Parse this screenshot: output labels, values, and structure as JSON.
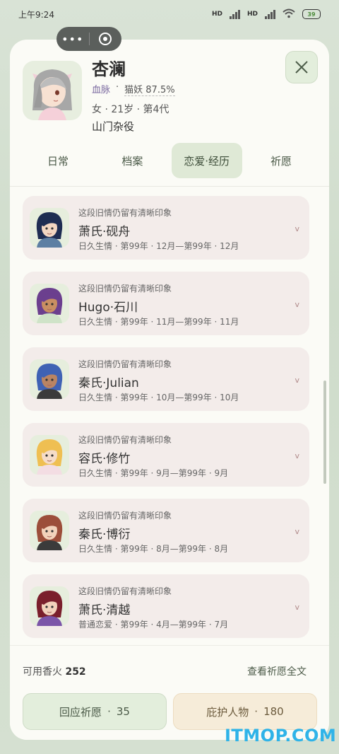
{
  "status_bar": {
    "time": "上午9:24",
    "hd1": "HD",
    "hd2": "HD",
    "battery": "39"
  },
  "profile": {
    "name": "杏澜",
    "lineage_label": "血脉",
    "lineage_value": "猫妖 87.5%",
    "meta": "女 · 21岁 · 第4代",
    "role": "山门杂役"
  },
  "tabs": [
    {
      "label": "日常",
      "active": false
    },
    {
      "label": "档案",
      "active": false
    },
    {
      "label": "恋爱·经历",
      "active": true
    },
    {
      "label": "祈愿",
      "active": false
    }
  ],
  "relationships": [
    {
      "note": "这段旧情仍留有清晰印象",
      "name": "萧氏·砚舟",
      "period": "日久生情 · 第99年 · 12月—第99年 · 12月",
      "hair": "#1e2d52",
      "shirt": "#5d7fa3",
      "skin": "#f2d6c1"
    },
    {
      "note": "这段旧情仍留有清晰印象",
      "name": "Hugo·石川",
      "period": "日久生情 · 第99年 · 11月—第99年 · 11月",
      "hair": "#6b3f8e",
      "shirt": "#cfe3c8",
      "skin": "#c98e62"
    },
    {
      "note": "这段旧情仍留有清晰印象",
      "name": "秦氏·Julian",
      "period": "日久生情 · 第99年 · 10月—第99年 · 10月",
      "hair": "#3f62b4",
      "shirt": "#3b3b3b",
      "skin": "#b98463"
    },
    {
      "note": "这段旧情仍留有清晰印象",
      "name": "容氏·修竹",
      "period": "日久生情 · 第99年 · 9月—第99年 · 9月",
      "hair": "#efbf52",
      "shirt": "#f3dde3",
      "skin": "#f5dcc8"
    },
    {
      "note": "这段旧情仍留有清晰印象",
      "name": "秦氏·博衍",
      "period": "日久生情 · 第99年 · 8月—第99年 · 8月",
      "hair": "#9c4e3a",
      "shirt": "#3b3b3b",
      "skin": "#f2d2bb"
    },
    {
      "note": "这段旧情仍留有清晰印象",
      "name": "萧氏·清越",
      "period": "普通恋爱 · 第99年 · 4月—第99年 · 7月",
      "hair": "#7a1f2b",
      "shirt": "#7b55a8",
      "skin": "#f2d2bb"
    }
  ],
  "footer": {
    "incense_label": "可用香火",
    "incense_value": "252",
    "fulltext_label": "查看祈愿全文",
    "respond_label": "回应祈愿",
    "respond_value": "35",
    "protect_label": "庇护人物",
    "protect_value": "180"
  },
  "watermark": "ITMOP.COM",
  "colors": {
    "accent": "#dfe9d6",
    "card_bg": "#f3ecea",
    "watermark": "#2fb3e8"
  }
}
